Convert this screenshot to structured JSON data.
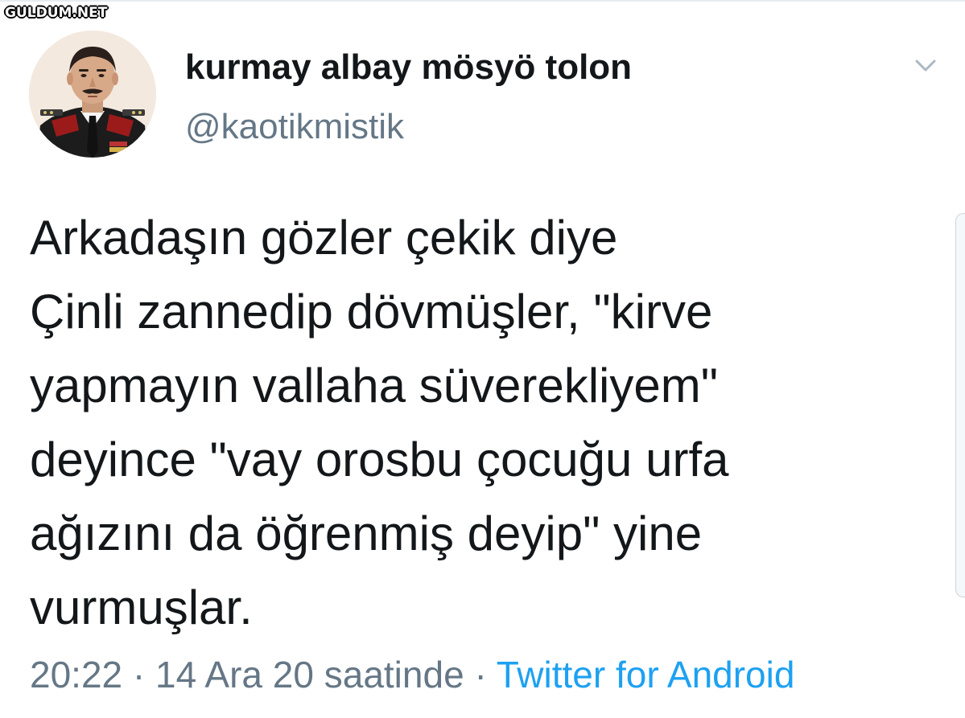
{
  "watermark": {
    "text": "GULDUM.NET"
  },
  "tweet": {
    "display_name": "kurmay albay mösyö tolon",
    "handle": "@kaotikmistik",
    "text": "Arkadaşın gözler çekik diye\nÇinli zannedip dövmüşler, \"kirve\nyapmayın vallaha süverekliyem\"\ndeyince \"vay orosbu çocuğu urfa\nağızını da öğrenmiş deyip\" yine\nvurmuşlar.",
    "time": "20:22",
    "date": "14 Ara 20 saatinde",
    "separator": "·",
    "source": "Twitter for Android"
  },
  "icons": {
    "more_menu": "chevron-down-icon",
    "avatar": "avatar"
  },
  "colors": {
    "text_primary": "#14171a",
    "text_secondary": "#657786",
    "link": "#1da1f2",
    "background": "#ffffff"
  }
}
